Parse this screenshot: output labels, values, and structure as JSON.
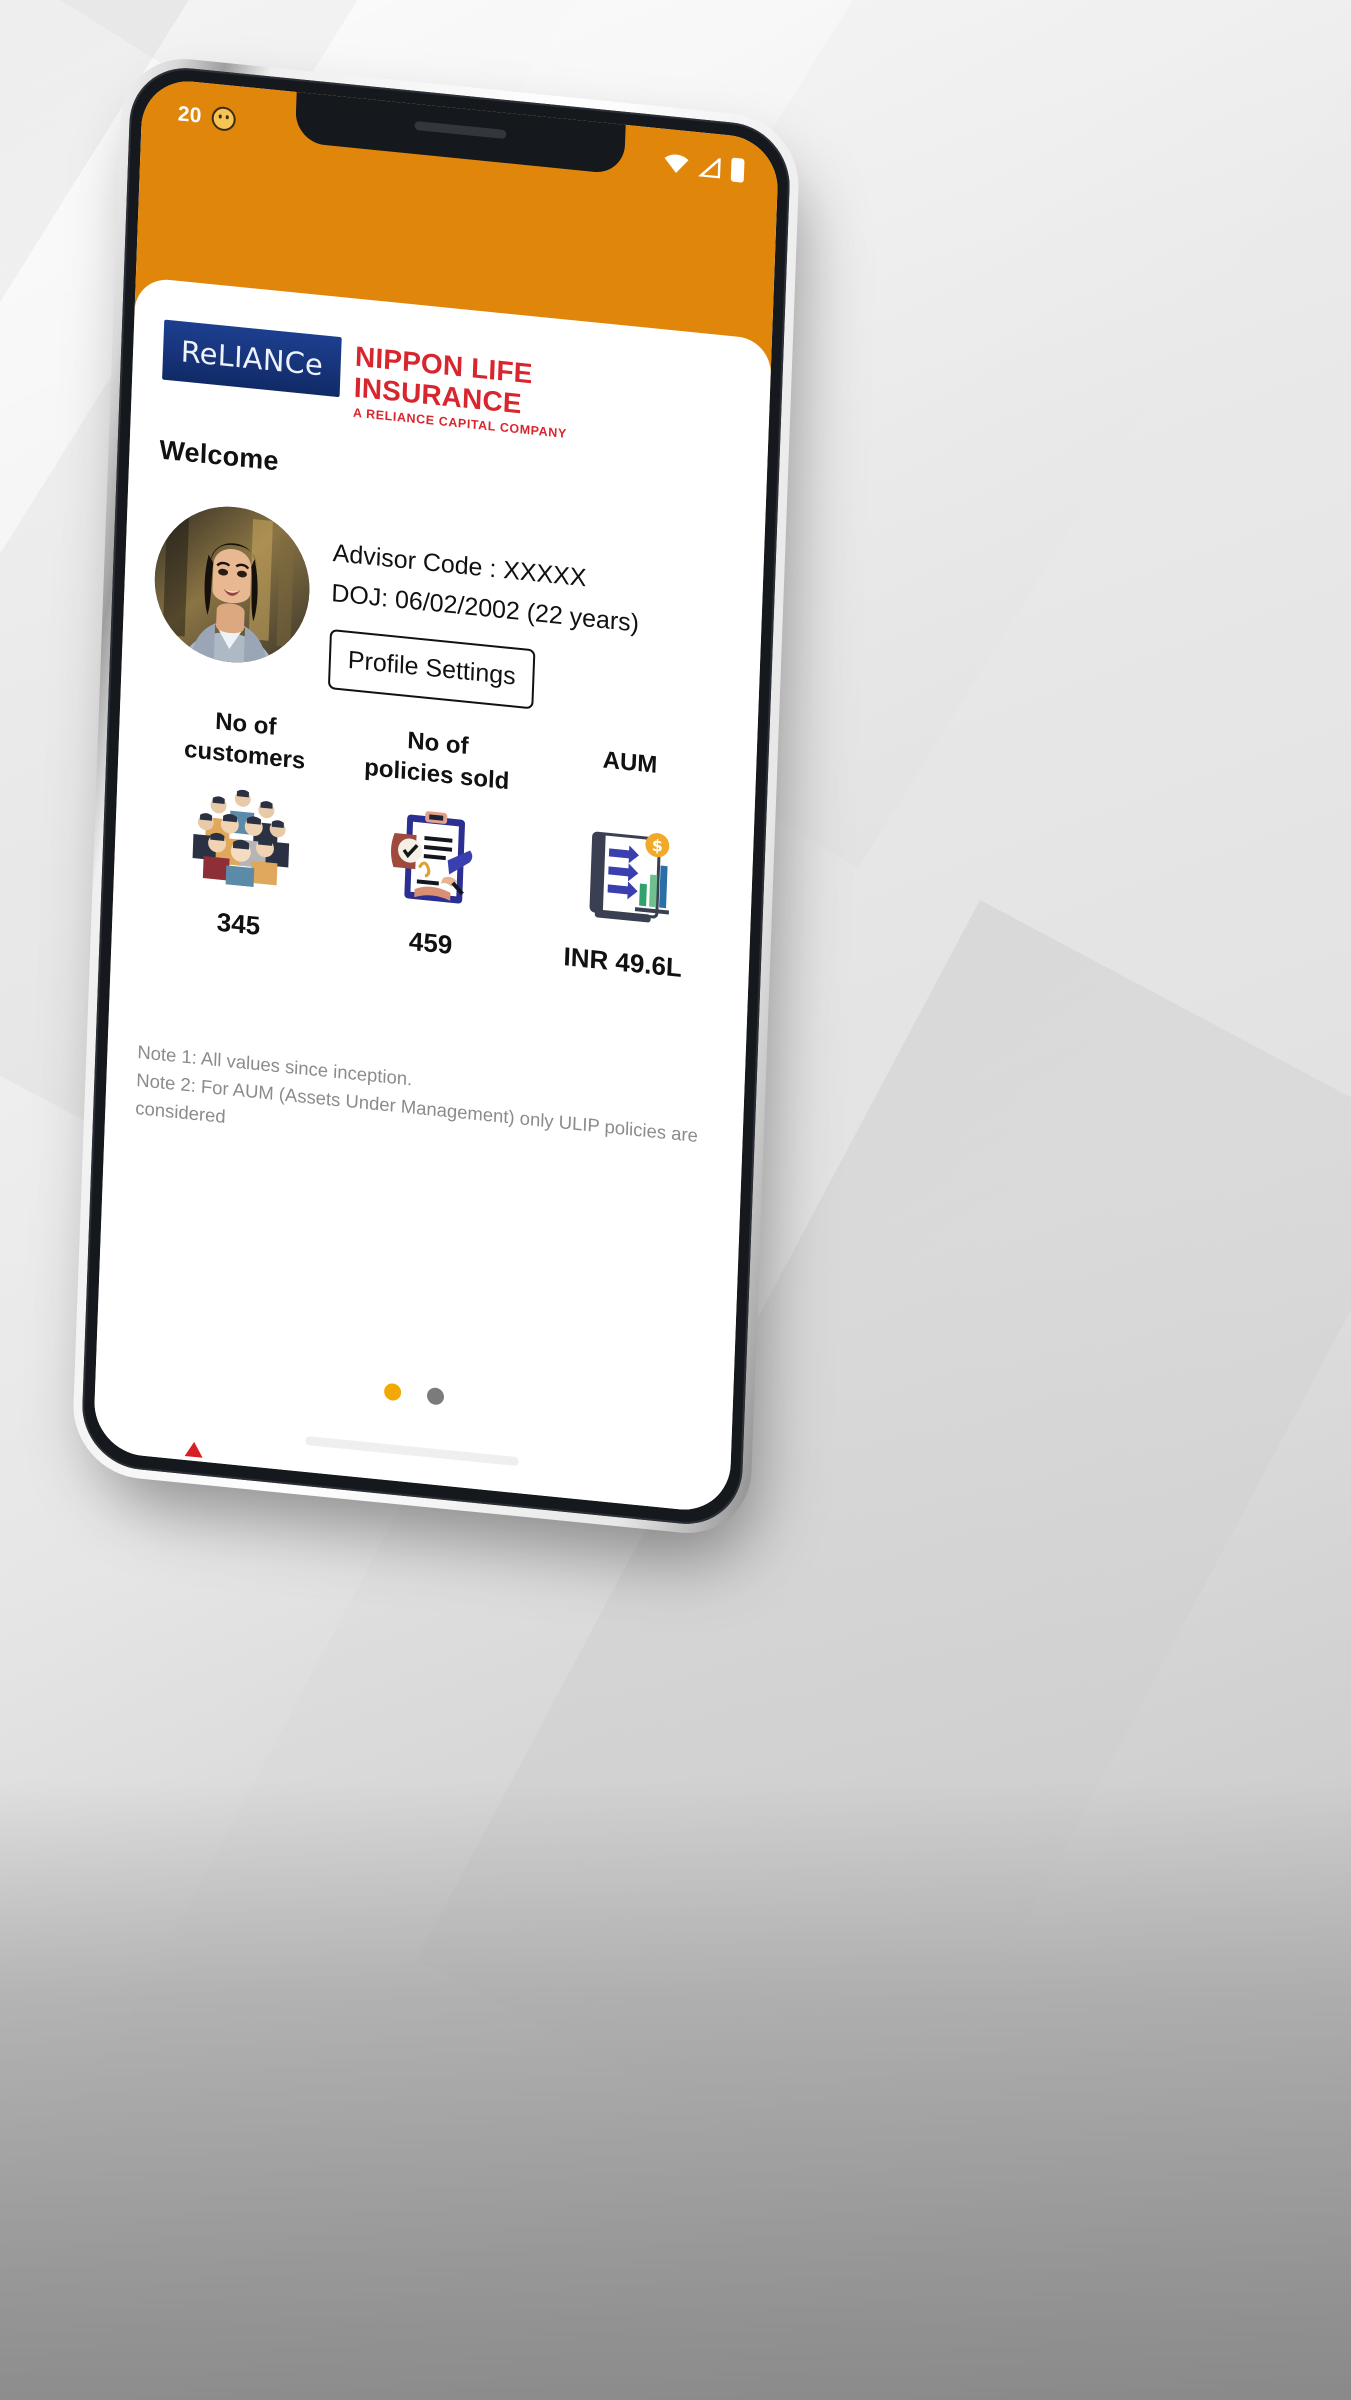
{
  "statusbar": {
    "time": "20",
    "emoji_icon": "smiley-icon",
    "wifi_icon": "wifi-icon",
    "signal_icon": "signal-icon",
    "battery_icon": "battery-icon"
  },
  "brand": {
    "mark_word": "ReLIANCe",
    "name_line1": "NIPPON LIFE",
    "name_line2": "INSURANCE",
    "tagline": "A RELIANCE CAPITAL COMPANY",
    "blue": "#17347a",
    "red": "#d8262e",
    "header_orange": "#e0860b"
  },
  "header": {
    "welcome": "Welcome"
  },
  "profile": {
    "avatar_name": "advisor-avatar",
    "advisor_code_line": "Advisor Code : XXXXX",
    "doj_line": "DOJ: 06/02/2002 (22 years)",
    "settings_button": "Profile Settings"
  },
  "stats": [
    {
      "label": "No of\ncustomers",
      "label_l1": "No of",
      "label_l2": "customers",
      "icon": "people-group-icon",
      "value": "345"
    },
    {
      "label": "No of\npolicies sold",
      "label_l1": "No of",
      "label_l2": "policies sold",
      "icon": "policy-clipboard-icon",
      "value": "459"
    },
    {
      "label": "AUM",
      "label_l1": "AUM",
      "label_l2": "",
      "icon": "aum-chart-icon",
      "value": "INR 49.6L"
    }
  ],
  "notes": {
    "line1": "Note 1: All values since inception.",
    "line2": "Note 2: For AUM (Assets Under Management) only ULIP policies are considered"
  },
  "pager": {
    "active_index": 0,
    "count": 2,
    "active_color": "#f2a905",
    "idle_color": "#7b7b7b"
  }
}
